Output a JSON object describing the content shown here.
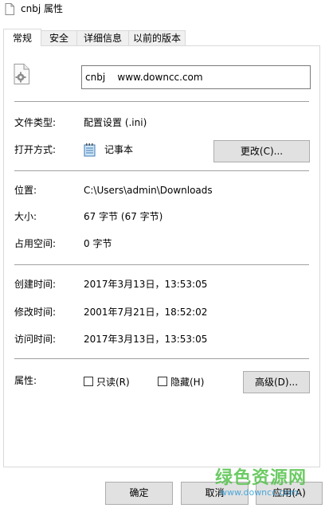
{
  "window": {
    "title": "cnbj 属性"
  },
  "tabs": [
    {
      "label": "常规",
      "active": true
    },
    {
      "label": "安全",
      "active": false
    },
    {
      "label": "详细信息",
      "active": false
    },
    {
      "label": "以前的版本",
      "active": false
    }
  ],
  "file": {
    "name": "cnbj    www.downcc.com",
    "icon": "ini-settings-file-icon"
  },
  "fields": {
    "type_label": "文件类型:",
    "type_value": "配置设置 (.ini)",
    "opens_label": "打开方式:",
    "opens_value": "记事本",
    "opens_icon": "notepad-icon",
    "change_button": "更改(C)...",
    "location_label": "位置:",
    "location_value": "C:\\Users\\admin\\Downloads",
    "size_label": "大小:",
    "size_value": "67 字节 (67 字节)",
    "disk_label": "占用空间:",
    "disk_value": "0 字节",
    "created_label": "创建时间:",
    "created_value": "2017年3月13日，13:53:05",
    "modified_label": "修改时间:",
    "modified_value": "2001年7月21日，18:52:02",
    "accessed_label": "访问时间:",
    "accessed_value": "2017年3月13日，13:53:05",
    "attrs_label": "属性:",
    "readonly_label": "只读(R)",
    "readonly_checked": false,
    "hidden_label": "隐藏(H)",
    "hidden_checked": false,
    "advanced_button": "高级(D)..."
  },
  "footer": {
    "ok": "确定",
    "cancel": "取消",
    "apply": "应用(A)"
  },
  "watermark": {
    "main": "绿色资源网",
    "sub": "www.downcc.com"
  }
}
